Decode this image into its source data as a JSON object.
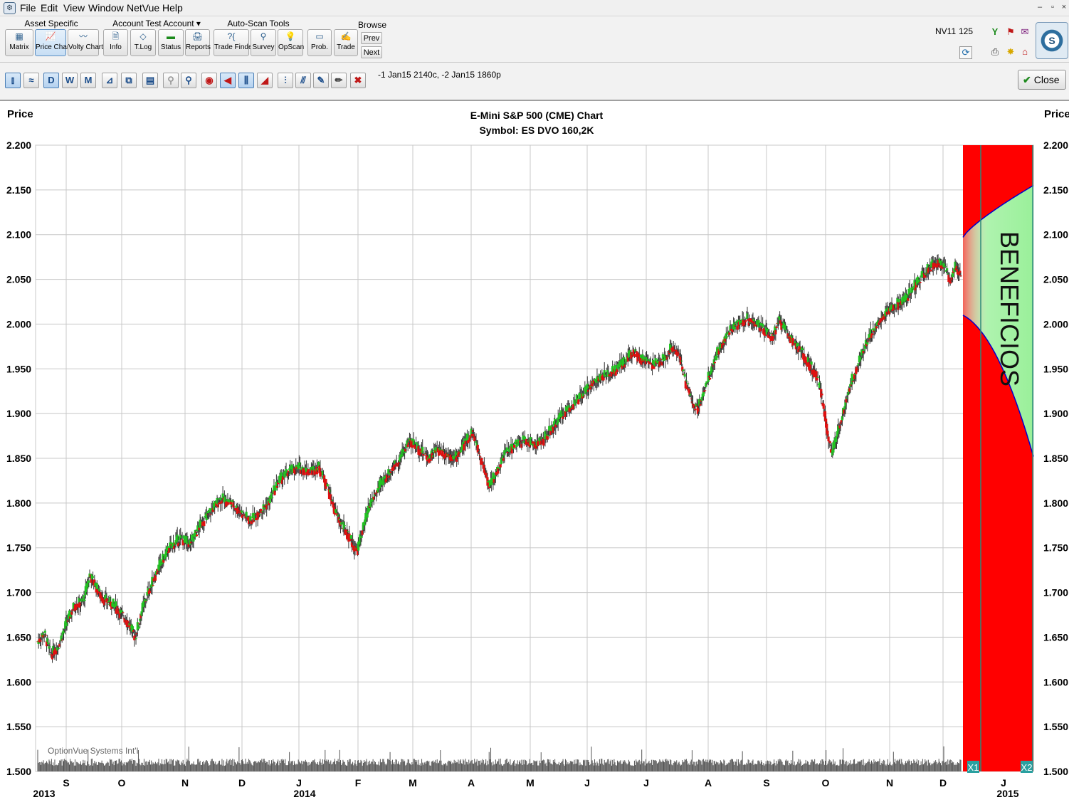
{
  "menu": {
    "items": [
      "File",
      "Edit",
      "View",
      "Window",
      "NetVue",
      "Help"
    ]
  },
  "window_controls": {
    "minimize": "–",
    "restore": "▫",
    "close": "×"
  },
  "toolbar": {
    "groups": [
      {
        "title": "Asset Specific",
        "buttons": [
          {
            "label": "Matrix",
            "icon": "matrix-icon"
          },
          {
            "label": "Price Chart",
            "icon": "price-chart-icon",
            "active": true
          },
          {
            "label": "Volty Chart",
            "icon": "volty-chart-icon"
          }
        ]
      },
      {
        "title": "Account Test Account ▾",
        "buttons": [
          {
            "label": "Info",
            "icon": "info-icon"
          },
          {
            "label": "T.Log",
            "icon": "trade-log-icon"
          },
          {
            "label": "Status",
            "icon": "status-icon"
          },
          {
            "label": "Reports",
            "icon": "reports-icon"
          }
        ]
      },
      {
        "title": "Auto-Scan Tools",
        "buttons": [
          {
            "label": "Trade Finder",
            "icon": "trade-finder-icon"
          },
          {
            "label": "Survey",
            "icon": "survey-icon"
          },
          {
            "label": "OpScan",
            "icon": "opscan-icon"
          }
        ]
      },
      {
        "title": "",
        "buttons": [
          {
            "label": "Prob.",
            "icon": "probability-icon"
          },
          {
            "label": "Trade",
            "icon": "trade-icon"
          }
        ]
      }
    ],
    "browse": {
      "title": "Browse",
      "prev": "Prev",
      "next": "Next"
    },
    "account_code": "NV11",
    "account_number": "125"
  },
  "chart_toolbar": {
    "period_buttons": [
      "D",
      "W",
      "M"
    ],
    "expiry_note": "-1 Jan15 2140c, -2 Jan15 1860p",
    "close_label": "Close"
  },
  "chart_data": {
    "type": "candlestick",
    "title": "E-Mini S&P 500 (CME) Chart",
    "subtitle": "Symbol: ES  DVO 160,2K",
    "ylabel_left": "Price",
    "ylabel_right": "Price",
    "ylim": [
      1500,
      2200
    ],
    "yticks": [
      "2.200",
      "2.150",
      "2.100",
      "2.050",
      "2.000",
      "1.950",
      "1.900",
      "1.850",
      "1.800",
      "1.750",
      "1.700",
      "1.650",
      "1.600",
      "1.550",
      "1.500"
    ],
    "ytick_values": [
      2200,
      2150,
      2100,
      2050,
      2000,
      1950,
      1900,
      1850,
      1800,
      1750,
      1700,
      1650,
      1600,
      1550,
      1500
    ],
    "month_labels": [
      "S",
      "O",
      "N",
      "D",
      "J",
      "F",
      "M",
      "A",
      "M",
      "J",
      "J",
      "A",
      "S",
      "O",
      "N",
      "D",
      "J"
    ],
    "year_labels": [
      "2013",
      "2014",
      "2015"
    ],
    "watermark": "OptionVue Systems Int'l",
    "annotation": "BENEFICIOS",
    "expiration_markers": [
      "X1",
      "X2"
    ],
    "colors": {
      "up": "#22c322",
      "down": "#e01010",
      "loss_zone": "#ff0000",
      "profit_zone": "#9af09a",
      "breakeven": "#0000cc",
      "grid": "#c8c8c8"
    },
    "price_path": [
      [
        0,
        1645
      ],
      [
        8,
        1655
      ],
      [
        16,
        1630
      ],
      [
        25,
        1640
      ],
      [
        35,
        1665
      ],
      [
        45,
        1685
      ],
      [
        56,
        1690
      ],
      [
        64,
        1720
      ],
      [
        70,
        1710
      ],
      [
        78,
        1695
      ],
      [
        86,
        1690
      ],
      [
        95,
        1685
      ],
      [
        104,
        1675
      ],
      [
        112,
        1665
      ],
      [
        120,
        1650
      ],
      [
        128,
        1680
      ],
      [
        138,
        1705
      ],
      [
        150,
        1730
      ],
      [
        162,
        1750
      ],
      [
        175,
        1760
      ],
      [
        188,
        1755
      ],
      [
        200,
        1775
      ],
      [
        212,
        1790
      ],
      [
        225,
        1805
      ],
      [
        238,
        1800
      ],
      [
        250,
        1790
      ],
      [
        262,
        1780
      ],
      [
        273,
        1790
      ],
      [
        284,
        1800
      ],
      [
        297,
        1825
      ],
      [
        310,
        1835
      ],
      [
        322,
        1840
      ],
      [
        334,
        1835
      ],
      [
        346,
        1840
      ],
      [
        356,
        1820
      ],
      [
        366,
        1790
      ],
      [
        375,
        1775
      ],
      [
        385,
        1760
      ],
      [
        393,
        1745
      ],
      [
        400,
        1770
      ],
      [
        410,
        1800
      ],
      [
        422,
        1820
      ],
      [
        434,
        1835
      ],
      [
        446,
        1850
      ],
      [
        458,
        1870
      ],
      [
        470,
        1860
      ],
      [
        481,
        1850
      ],
      [
        492,
        1860
      ],
      [
        503,
        1855
      ],
      [
        514,
        1850
      ],
      [
        525,
        1865
      ],
      [
        535,
        1880
      ],
      [
        542,
        1860
      ],
      [
        549,
        1840
      ],
      [
        556,
        1820
      ],
      [
        563,
        1830
      ],
      [
        575,
        1855
      ],
      [
        588,
        1865
      ],
      [
        600,
        1870
      ],
      [
        612,
        1865
      ],
      [
        622,
        1870
      ],
      [
        635,
        1885
      ],
      [
        647,
        1900
      ],
      [
        659,
        1910
      ],
      [
        671,
        1920
      ],
      [
        683,
        1935
      ],
      [
        694,
        1940
      ],
      [
        706,
        1945
      ],
      [
        720,
        1955
      ],
      [
        733,
        1970
      ],
      [
        745,
        1960
      ],
      [
        758,
        1955
      ],
      [
        770,
        1960
      ],
      [
        782,
        1975
      ],
      [
        790,
        1965
      ],
      [
        796,
        1940
      ],
      [
        802,
        1925
      ],
      [
        807,
        1910
      ],
      [
        813,
        1905
      ],
      [
        820,
        1925
      ],
      [
        828,
        1945
      ],
      [
        838,
        1970
      ],
      [
        850,
        1990
      ],
      [
        862,
        2000
      ],
      [
        874,
        2005
      ],
      [
        886,
        2000
      ],
      [
        897,
        1990
      ],
      [
        906,
        1985
      ],
      [
        912,
        2005
      ],
      [
        920,
        1995
      ],
      [
        930,
        1980
      ],
      [
        940,
        1970
      ],
      [
        950,
        1955
      ],
      [
        958,
        1945
      ],
      [
        964,
        1925
      ],
      [
        970,
        1895
      ],
      [
        974,
        1870
      ],
      [
        978,
        1855
      ],
      [
        983,
        1870
      ],
      [
        990,
        1895
      ],
      [
        998,
        1925
      ],
      [
        1008,
        1950
      ],
      [
        1018,
        1975
      ],
      [
        1030,
        1995
      ],
      [
        1042,
        2010
      ],
      [
        1054,
        2020
      ],
      [
        1066,
        2025
      ],
      [
        1078,
        2040
      ],
      [
        1090,
        2055
      ],
      [
        1100,
        2065
      ],
      [
        1110,
        2070
      ],
      [
        1118,
        2060
      ],
      [
        1124,
        2050
      ],
      [
        1130,
        2065
      ],
      [
        1137,
        2055
      ]
    ]
  }
}
